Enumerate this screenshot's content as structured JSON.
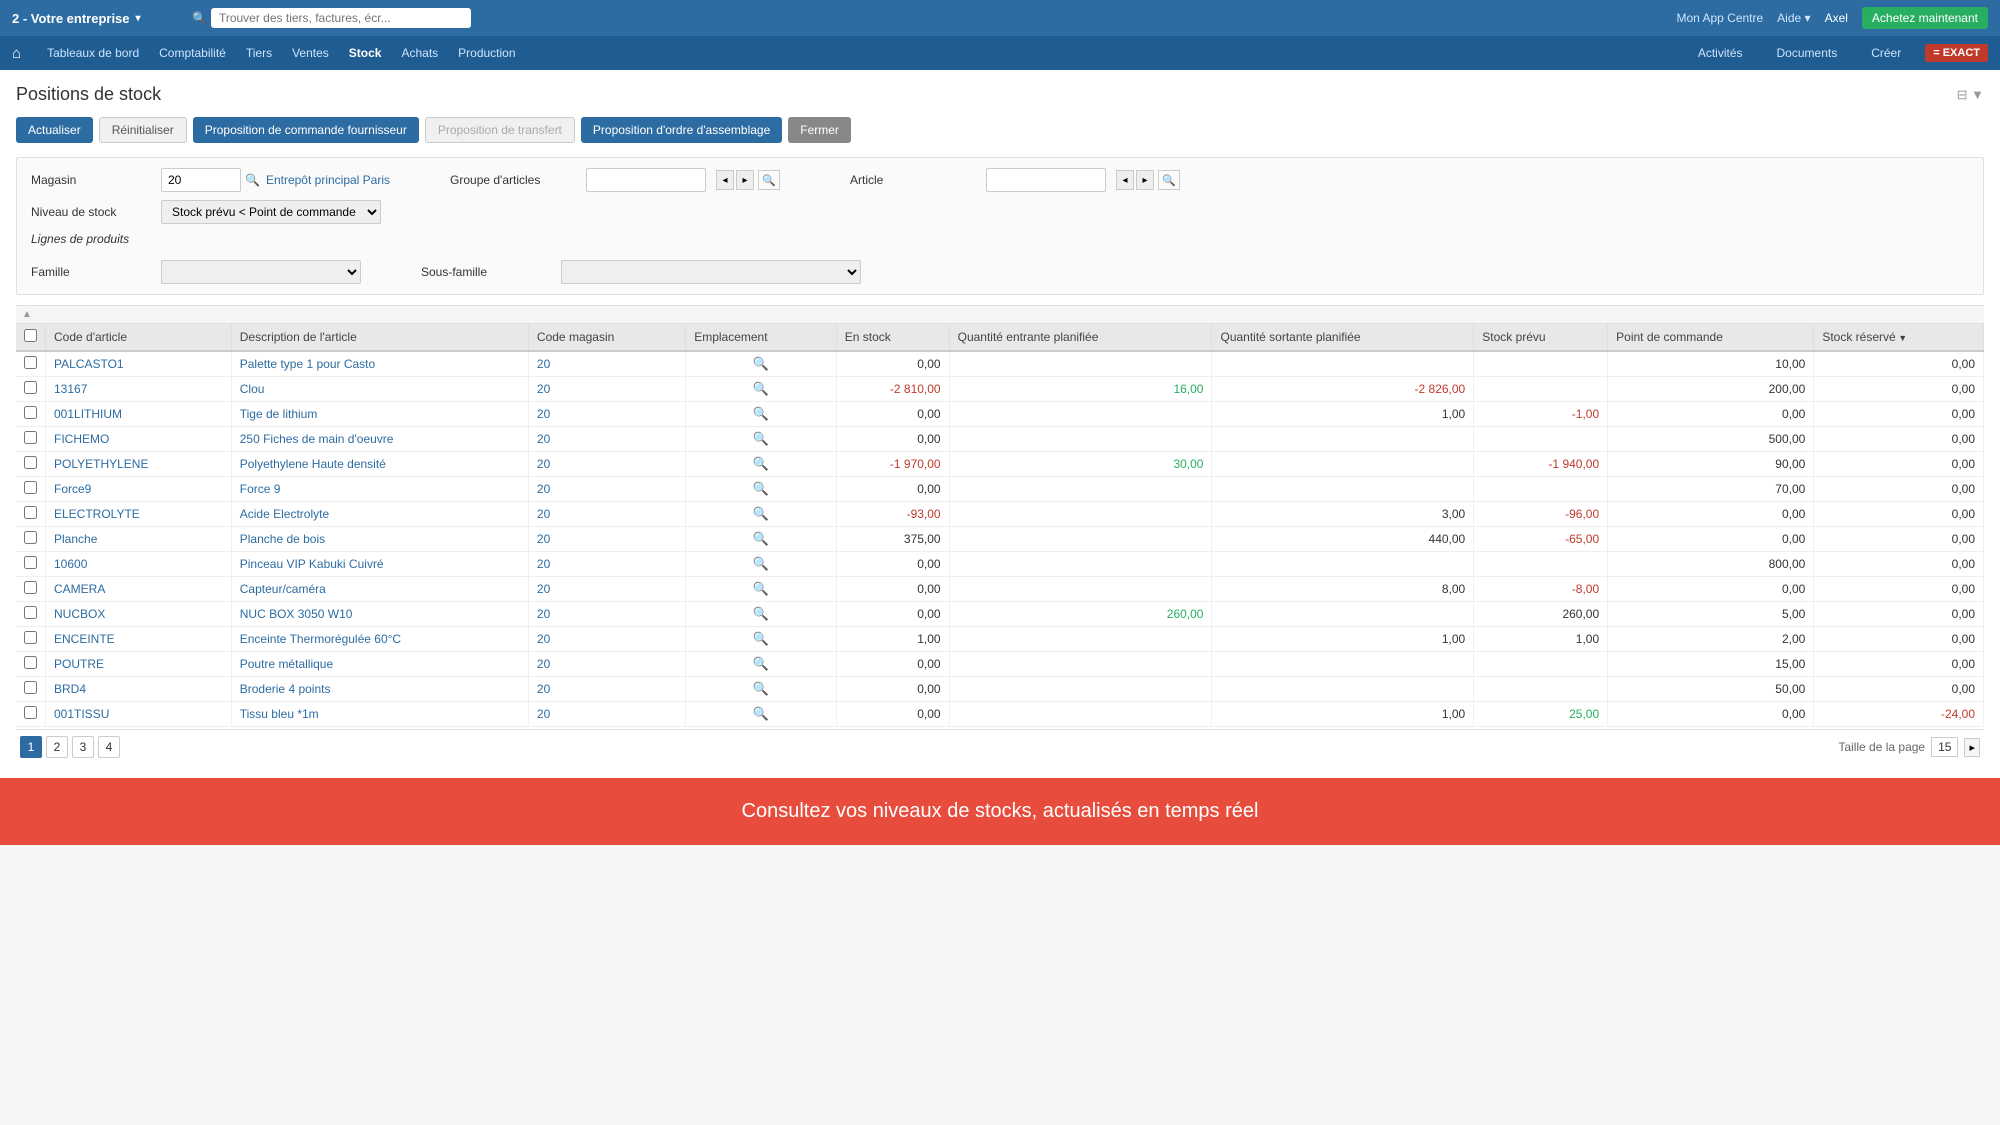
{
  "topbar": {
    "company": "2 - Votre entreprise",
    "search_placeholder": "Trouver des tiers, factures, écr...",
    "app_centre": "Mon App Centre",
    "aide": "Aide",
    "user": "Axel",
    "btn_achetez": "Achetez maintenant"
  },
  "mainnav": {
    "home_icon": "⌂",
    "items": [
      {
        "label": "Tableaux de bord"
      },
      {
        "label": "Comptabilité"
      },
      {
        "label": "Tiers"
      },
      {
        "label": "Ventes"
      },
      {
        "label": "Stock"
      },
      {
        "label": "Achats"
      },
      {
        "label": "Production"
      }
    ],
    "right_items": [
      {
        "label": "Activités"
      },
      {
        "label": "Documents"
      },
      {
        "label": "Créer"
      }
    ],
    "exact_logo": "= EXACT"
  },
  "page": {
    "title": "Positions de stock",
    "settings_icon": "⊞"
  },
  "toolbar": {
    "btn_actualiser": "Actualiser",
    "btn_reinitialiser": "Réinitialiser",
    "btn_proposition_commande": "Proposition de commande fournisseur",
    "btn_proposition_transfert": "Proposition de transfert",
    "btn_proposition_assemblage": "Proposition d'ordre d'assemblage",
    "btn_fermer": "Fermer"
  },
  "filters": {
    "magasin_label": "Magasin",
    "magasin_value": "20",
    "magasin_link": "Entrepôt principal Paris",
    "groupe_articles_label": "Groupe d'articles",
    "article_label": "Article",
    "niveau_stock_label": "Niveau de stock",
    "niveau_stock_value": "Stock prévu < Point de commande",
    "lignes_label": "Lignes de produits",
    "famille_label": "Famille",
    "sous_famille_label": "Sous-famille"
  },
  "table": {
    "columns": [
      {
        "label": "Code d'article"
      },
      {
        "label": "Description de l'article"
      },
      {
        "label": "Code magasin"
      },
      {
        "label": "Emplacement"
      },
      {
        "label": "En stock"
      },
      {
        "label": "Quantité entrante planifiée"
      },
      {
        "label": "Quantité sortante planifiée"
      },
      {
        "label": "Stock prévu"
      },
      {
        "label": "Point de commande"
      },
      {
        "label": "Stock réservé",
        "sorted": true
      }
    ],
    "rows": [
      {
        "code": "PALCASTO1",
        "description": "Palette type 1 pour Casto",
        "magasin": "20",
        "emplacement": "icon",
        "en_stock": "0,00",
        "qte_entrante": "",
        "qte_sortante": "",
        "stock_prevu": "",
        "point_commande": "10,00",
        "stock_reserve": "0,00"
      },
      {
        "code": "13167",
        "description": "Clou",
        "magasin": "20",
        "emplacement": "icon",
        "en_stock": "-2 810,00",
        "en_stock_neg": true,
        "qte_entrante": "16,00",
        "qte_sortante": "-2 826,00",
        "qte_sortante_neg": true,
        "stock_prevu": "",
        "point_commande": "200,00",
        "stock_reserve": "0,00"
      },
      {
        "code": "001LITHIUM",
        "description": "Tige de lithium",
        "magasin": "20",
        "emplacement": "icon",
        "en_stock": "0,00",
        "qte_entrante": "",
        "qte_sortante": "1,00",
        "stock_prevu": "-1,00",
        "stock_prevu_neg": true,
        "point_commande": "0,00",
        "stock_reserve": "0,00"
      },
      {
        "code": "FICHEMO",
        "description": "250 Fiches de main d'oeuvre",
        "magasin": "20",
        "emplacement": "icon",
        "en_stock": "0,00",
        "qte_entrante": "",
        "qte_sortante": "",
        "stock_prevu": "",
        "point_commande": "500,00",
        "stock_reserve": "0,00"
      },
      {
        "code": "POLYETHYLENE",
        "description": "Polyethylene Haute densité",
        "magasin": "20",
        "emplacement": "icon",
        "en_stock": "-1 970,00",
        "en_stock_neg": true,
        "qte_entrante": "30,00",
        "qte_sortante": "",
        "stock_prevu": "-1 940,00",
        "stock_prevu_neg": true,
        "point_commande": "90,00",
        "stock_reserve": "0,00"
      },
      {
        "code": "Force9",
        "description": "Force 9",
        "magasin": "20",
        "emplacement": "icon",
        "en_stock": "0,00",
        "qte_entrante": "",
        "qte_sortante": "",
        "stock_prevu": "",
        "point_commande": "70,00",
        "stock_reserve": "0,00"
      },
      {
        "code": "ELECTROLYTE",
        "description": "Acide Electrolyte",
        "magasin": "20",
        "emplacement": "icon",
        "en_stock": "-93,00",
        "en_stock_neg": true,
        "qte_entrante": "",
        "qte_sortante": "3,00",
        "stock_prevu": "-96,00",
        "stock_prevu_neg": true,
        "point_commande": "0,00",
        "stock_reserve": "0,00"
      },
      {
        "code": "Planche",
        "description": "Planche de bois",
        "magasin": "20",
        "emplacement": "icon",
        "en_stock": "375,00",
        "qte_entrante": "",
        "qte_sortante": "440,00",
        "stock_prevu": "-65,00",
        "stock_prevu_neg": true,
        "point_commande": "0,00",
        "stock_reserve": "0,00"
      },
      {
        "code": "10600",
        "description": "Pinceau VIP Kabuki Cuivré",
        "magasin": "20",
        "emplacement": "icon",
        "en_stock": "0,00",
        "qte_entrante": "",
        "qte_sortante": "",
        "stock_prevu": "",
        "point_commande": "800,00",
        "stock_reserve": "0,00"
      },
      {
        "code": "CAMERA",
        "description": "Capteur/caméra",
        "magasin": "20",
        "emplacement": "icon",
        "en_stock": "0,00",
        "qte_entrante": "",
        "qte_sortante": "8,00",
        "stock_prevu": "-8,00",
        "stock_prevu_neg": true,
        "point_commande": "0,00",
        "stock_reserve": "0,00"
      },
      {
        "code": "NUCBOX",
        "description": "NUC BOX 3050 W10",
        "magasin": "20",
        "emplacement": "icon",
        "en_stock": "0,00",
        "qte_entrante": "260,00",
        "qte_sortante": "",
        "stock_prevu": "260,00",
        "point_commande": "5,00",
        "stock_reserve": "0,00"
      },
      {
        "code": "ENCEINTE",
        "description": "Enceinte Thermorégulée 60°C",
        "magasin": "20",
        "emplacement": "icon",
        "en_stock": "1,00",
        "qte_entrante": "",
        "qte_sortante": "1,00",
        "stock_prevu": "1,00",
        "point_commande": "2,00",
        "stock_reserve": "0,00"
      },
      {
        "code": "POUTRE",
        "description": "Poutre métallique",
        "magasin": "20",
        "emplacement": "icon",
        "en_stock": "0,00",
        "qte_entrante": "",
        "qte_sortante": "",
        "stock_prevu": "",
        "point_commande": "15,00",
        "stock_reserve": "0,00"
      },
      {
        "code": "BRD4",
        "description": "Broderie 4 points",
        "magasin": "20",
        "emplacement": "icon",
        "en_stock": "0,00",
        "qte_entrante": "",
        "qte_sortante": "",
        "stock_prevu": "",
        "point_commande": "50,00",
        "stock_reserve": "0,00"
      },
      {
        "code": "001TISSU",
        "description": "Tissu bleu *1m",
        "magasin": "20",
        "emplacement": "icon",
        "en_stock": "0,00",
        "qte_entrante": "",
        "qte_sortante": "1,00",
        "stock_prevu": "25,00",
        "stock_prevu_pos": true,
        "point_commande": "0,00",
        "stock_reserve": "-24,00",
        "stock_reserve_neg": true
      }
    ]
  },
  "pagination": {
    "pages": [
      "1",
      "2",
      "3",
      "4"
    ],
    "current_page": "1",
    "page_size_label": "Taille de la page",
    "page_size": "15"
  },
  "footer_banner": {
    "text": "Consultez vos niveaux de stocks, actualisés en temps réel"
  }
}
